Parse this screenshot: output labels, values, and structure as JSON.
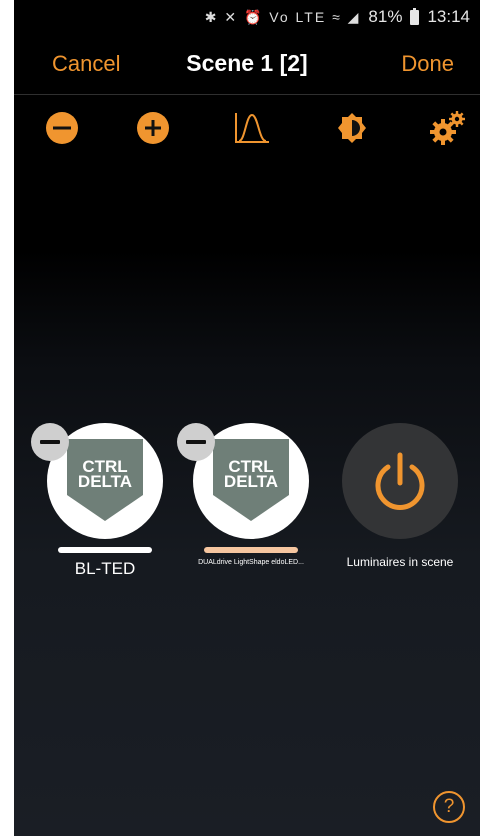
{
  "status_bar": {
    "icons": "✱ ✕ ⏰ Vo LTE ≈ ◢",
    "battery": "81%",
    "time": "13:14"
  },
  "header": {
    "cancel_label": "Cancel",
    "title": "Scene 1 [2]",
    "done_label": "Done"
  },
  "toolbar": {
    "items": [
      "minus-circle-icon",
      "plus-circle-icon",
      "light-curve-icon",
      "brightness-icon",
      "settings-gears-icon"
    ]
  },
  "luminaires": [
    {
      "logo_line1": "CTRL",
      "logo_line2": "DELTA",
      "name": "BL-TED",
      "bar_color": "#ffffff"
    },
    {
      "logo_line1": "CTRL",
      "logo_line2": "DELTA",
      "name": "DUALdrive LightShape eldoLED...",
      "bar_color": "#f6c6a0"
    }
  ],
  "scene_toggle": {
    "label": "Luminaires in scene",
    "icon": "power-icon"
  },
  "help": {
    "label": "?"
  },
  "colors": {
    "accent": "#f0952f",
    "logo_shield": "#6f7f78"
  }
}
